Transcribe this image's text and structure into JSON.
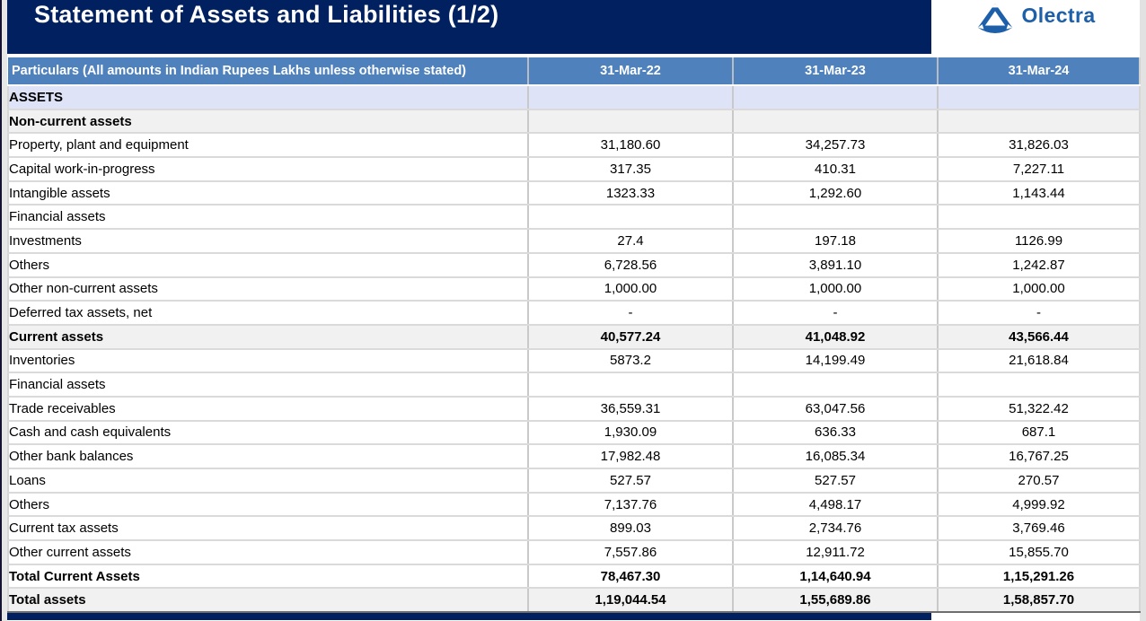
{
  "slide": {
    "title": "Statement of Assets and Liabilities (1/2)"
  },
  "logo": {
    "company": "Olectra",
    "icon": "olectra-triangle-logo",
    "color": "#1d5fa9"
  },
  "colors": {
    "navy_bar": "#002060",
    "header_blue": "#4f81bd",
    "lavender_row": "#dee3f7",
    "gray_row": "#f1f1f2"
  },
  "table": {
    "header": {
      "particulars": "Particulars  (All amounts in Indian Rupees Lakhs unless otherwise stated)",
      "columns": [
        "31-Mar-22",
        "31-Mar-23",
        "31-Mar-24"
      ]
    },
    "rows": [
      {
        "label": "ASSETS",
        "values": [
          "",
          "",
          ""
        ],
        "indent": 0,
        "bold": true,
        "bg": "lavender"
      },
      {
        "label": "Non-current assets",
        "values": [
          "",
          "",
          ""
        ],
        "indent": 0,
        "bold": true,
        "bg": "gray"
      },
      {
        "label": "Property, plant and equipment",
        "values": [
          "31,180.60",
          "34,257.73",
          "31,826.03"
        ],
        "indent": 1,
        "bold": false,
        "bg": ""
      },
      {
        "label": "Capital work-in-progress",
        "values": [
          "317.35",
          "410.31",
          "7,227.11"
        ],
        "indent": 1,
        "bold": false,
        "bg": ""
      },
      {
        "label": "Intangible assets",
        "values": [
          "1323.33",
          "1,292.60",
          "1,143.44"
        ],
        "indent": 1,
        "bold": false,
        "bg": ""
      },
      {
        "label": "Financial assets",
        "values": [
          "",
          "",
          ""
        ],
        "indent": 1,
        "bold": false,
        "bg": ""
      },
      {
        "label": "Investments",
        "values": [
          "27.4",
          "197.18",
          "1126.99"
        ],
        "indent": 2,
        "bold": false,
        "bg": ""
      },
      {
        "label": "Others",
        "values": [
          "6,728.56",
          "3,891.10",
          "1,242.87"
        ],
        "indent": 2,
        "bold": false,
        "bg": ""
      },
      {
        "label": "Other non-current assets",
        "values": [
          "1,000.00",
          "1,000.00",
          "1,000.00"
        ],
        "indent": 1,
        "bold": false,
        "bg": ""
      },
      {
        "label": "Deferred tax assets, net",
        "values": [
          "-",
          "-",
          "-"
        ],
        "indent": 1,
        "bold": false,
        "bg": ""
      },
      {
        "label": "Current assets",
        "values": [
          "40,577.24",
          "41,048.92",
          "43,566.44"
        ],
        "indent": 0,
        "bold": true,
        "bg": "gray"
      },
      {
        "label": "Inventories",
        "values": [
          "5873.2",
          "14,199.49",
          "21,618.84"
        ],
        "indent": 1,
        "bold": false,
        "bg": ""
      },
      {
        "label": "Financial assets",
        "values": [
          "",
          "",
          ""
        ],
        "indent": 1,
        "bold": false,
        "bg": ""
      },
      {
        "label": "Trade receivables",
        "values": [
          "36,559.31",
          "63,047.56",
          "51,322.42"
        ],
        "indent": 2,
        "bold": false,
        "bg": ""
      },
      {
        "label": "Cash and cash equivalents",
        "values": [
          "1,930.09",
          "636.33",
          "687.1"
        ],
        "indent": 2,
        "bold": false,
        "bg": ""
      },
      {
        "label": "Other bank balances",
        "values": [
          "17,982.48",
          "16,085.34",
          "16,767.25"
        ],
        "indent": 2,
        "bold": false,
        "bg": ""
      },
      {
        "label": "Loans",
        "values": [
          "527.57",
          "527.57",
          "270.57"
        ],
        "indent": 2,
        "bold": false,
        "bg": ""
      },
      {
        "label": "Others",
        "values": [
          "7,137.76",
          "4,498.17",
          "4,999.92"
        ],
        "indent": 2,
        "bold": false,
        "bg": ""
      },
      {
        "label": "Current tax assets",
        "values": [
          "899.03",
          "2,734.76",
          "3,769.46"
        ],
        "indent": 1,
        "bold": false,
        "bg": ""
      },
      {
        "label": "Other current assets",
        "values": [
          "7,557.86",
          "12,911.72",
          "15,855.70"
        ],
        "indent": 1,
        "bold": false,
        "bg": ""
      },
      {
        "label": "Total Current Assets",
        "values": [
          "78,467.30",
          "1,14,640.94",
          "1,15,291.26"
        ],
        "indent": 1,
        "bold": true,
        "bg": ""
      },
      {
        "label": "Total assets",
        "values": [
          "1,19,044.54",
          "1,55,689.86",
          "1,58,857.70"
        ],
        "indent": 0,
        "bold": true,
        "bg": "gray"
      }
    ]
  }
}
